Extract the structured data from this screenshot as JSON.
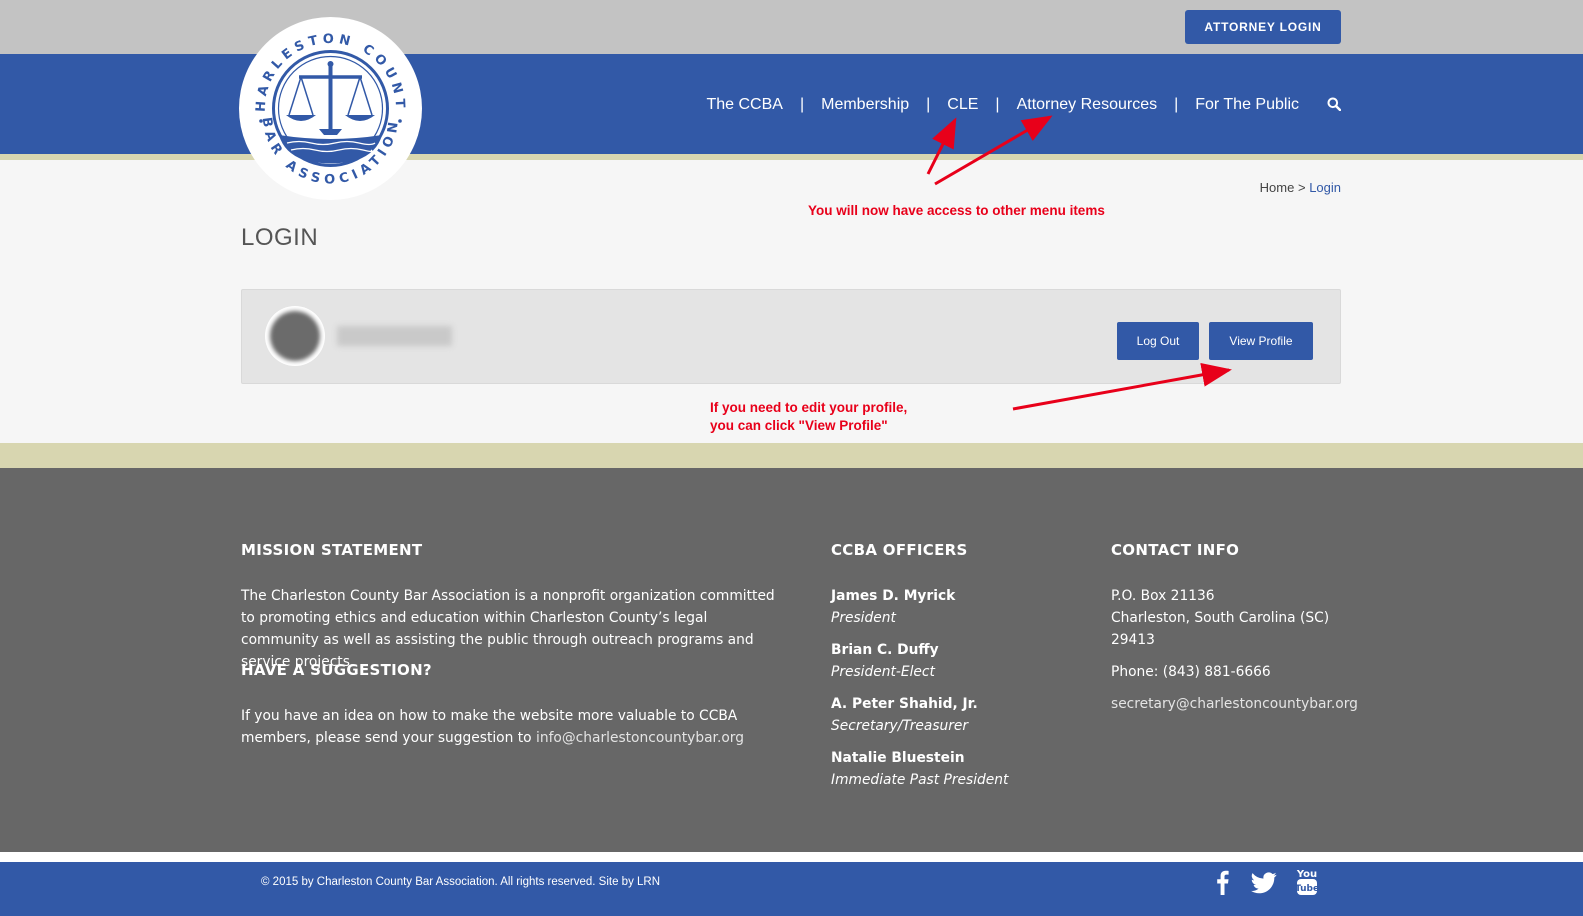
{
  "header": {
    "attorney_login": "ATTORNEY LOGIN",
    "logo_alt": "Charleston County Bar Association",
    "nav": [
      "The CCBA",
      "Membership",
      "CLE",
      "Attorney Resources",
      "For The Public"
    ],
    "nav_separator": "|"
  },
  "breadcrumb": {
    "home": "Home",
    "sep": " > ",
    "current": "Login"
  },
  "page_title": "LOGIN",
  "profile": {
    "logout": "Log Out",
    "view_profile": "View Profile"
  },
  "annotations": {
    "menu": "You will now have access to other menu items",
    "profile_line1": "If you need to edit your profile,",
    "profile_line2": "you can click \"View Profile\""
  },
  "footer": {
    "mission": {
      "title": "MISSION STATEMENT",
      "text": "The Charleston County Bar Association is a nonprofit organization committed to promoting ethics and education within Charleston County’s legal community as well as assisting the public through outreach programs and service projects."
    },
    "suggestion": {
      "title": "HAVE A SUGGESTION?",
      "text": "If you have an idea on how to make the website more valuable to CCBA members, please send your suggestion to ",
      "email": "info@charlestoncountybar.org"
    },
    "officers": {
      "title": "CCBA OFFICERS",
      "list": [
        {
          "name": "James D. Myrick",
          "role": "President"
        },
        {
          "name": "Brian C. Duffy",
          "role": "President-Elect"
        },
        {
          "name": "A. Peter Shahid, Jr.",
          "role": "Secretary/Treasurer"
        },
        {
          "name": "Natalie Bluestein",
          "role": "Immediate Past President"
        }
      ]
    },
    "contact": {
      "title": "CONTACT INFO",
      "address1": "P.O. Box 21136",
      "address2": "Charleston, South Carolina (SC)",
      "zip": "29413",
      "phone": "Phone: (843) 881-6666",
      "email": "secretary@charlestoncountybar.org"
    }
  },
  "bottom": {
    "copyright": "© 2015 by Charleston County Bar Association. All rights reserved. Site by LRN",
    "social": [
      "facebook-icon",
      "twitter-icon",
      "youtube-icon"
    ]
  },
  "colors": {
    "primary": "#3259a7",
    "topbar": "#c3c3c3",
    "stripe": "#d8d6b0",
    "footer": "#676767",
    "annotation": "#e8001a"
  }
}
